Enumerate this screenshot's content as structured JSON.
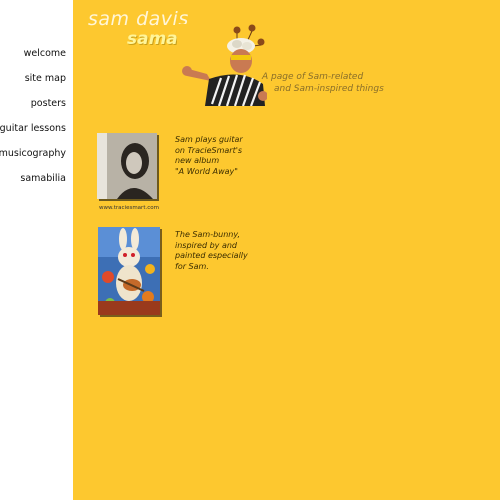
{
  "nav": {
    "items": [
      {
        "label": "welcome"
      },
      {
        "label": "site map"
      },
      {
        "label": "posters"
      },
      {
        "label": "guitar lessons"
      },
      {
        "label": "musicography"
      },
      {
        "label": "samabilia"
      }
    ]
  },
  "header": {
    "name": "sam davis",
    "section": "samabilia",
    "tagline_line1": "A page of Sam-related",
    "tagline_line2": "and Sam-inspired things"
  },
  "items": [
    {
      "caption": "www.traciesmart.com",
      "description": "Sam plays guitar\non TracieSmart's\nnew album\n\"A World Away\""
    },
    {
      "description": "The Sam-bunny,\ninspired by and\npainted especially\nfor Sam."
    }
  ],
  "colors": {
    "background": "#fdc82f",
    "sidebar": "#ffffff"
  }
}
